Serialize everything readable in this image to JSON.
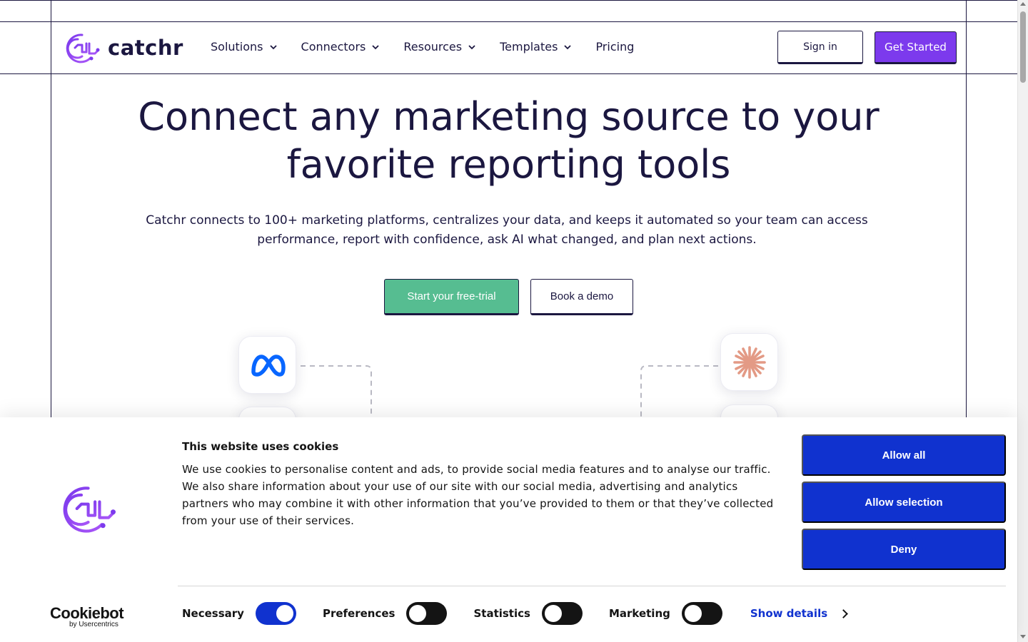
{
  "header": {
    "logo_text": "catchr",
    "nav": [
      {
        "label": "Solutions",
        "has_dropdown": true
      },
      {
        "label": "Connectors",
        "has_dropdown": true
      },
      {
        "label": "Resources",
        "has_dropdown": true
      },
      {
        "label": "Templates",
        "has_dropdown": true
      },
      {
        "label": "Pricing",
        "has_dropdown": false
      }
    ],
    "sign_in_label": "Sign in",
    "get_started_label": "Get Started"
  },
  "hero": {
    "title_line1": "Connect any marketing source to your",
    "title_line2": "favorite reporting tools",
    "subtitle": "Catchr connects to 100+ marketing platforms, centralizes your data, and keeps it automated so your team can access performance, report with confidence, ask AI what changed, and plan next actions.",
    "trial_label": "Start your free-trial",
    "demo_label": "Book a demo",
    "source_icons": [
      "meta-icon",
      "claude-icon"
    ]
  },
  "cookie_banner": {
    "title": "This website uses cookies",
    "text": "We use cookies to personalise content and ads, to provide social media features and to analyse our traffic. We also share information about your use of our site with our social media, advertising and analytics partners who may combine it with other information that you’ve provided to them or that they’ve collected from your use of their services.",
    "allow_all_label": "Allow all",
    "allow_selection_label": "Allow selection",
    "deny_label": "Deny",
    "brand_main": "Cookiebot",
    "brand_sub": "by Usercentrics",
    "toggles": [
      {
        "label": "Necessary",
        "on": true
      },
      {
        "label": "Preferences",
        "on": false
      },
      {
        "label": "Statistics",
        "on": false
      },
      {
        "label": "Marketing",
        "on": false
      }
    ],
    "show_details_label": "Show details"
  },
  "colors": {
    "brand_purple": "#7c3aed",
    "navy": "#1b1740",
    "trial_green": "#56bd91",
    "cookie_blue": "#1032cf"
  }
}
